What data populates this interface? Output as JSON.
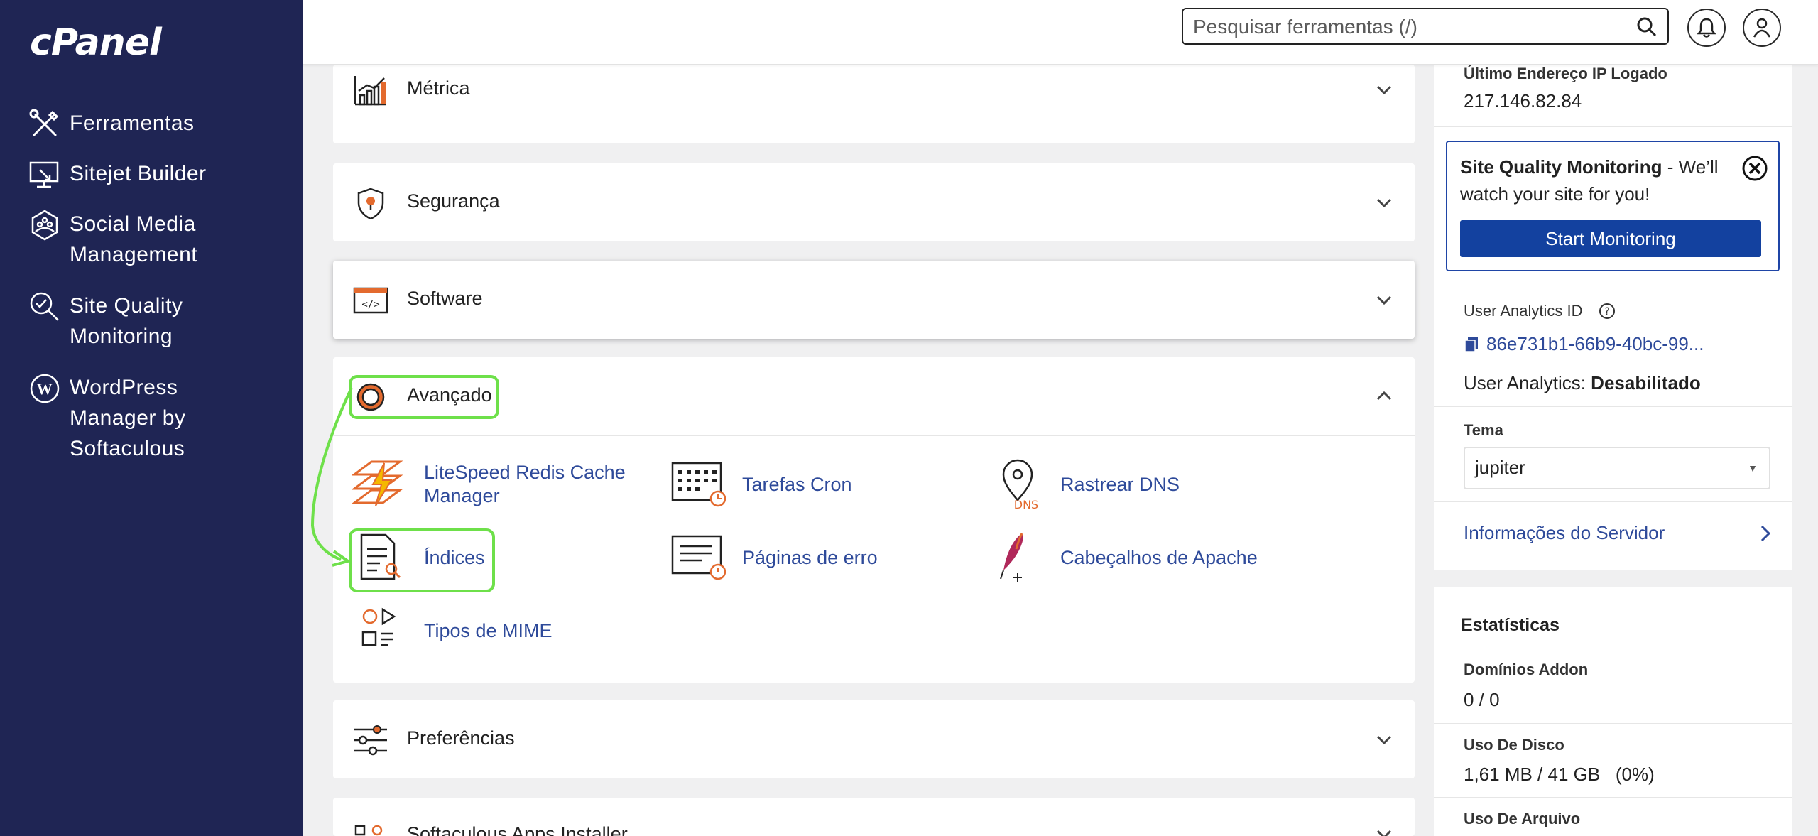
{
  "sidebar": {
    "logo": "cPanel",
    "items": [
      {
        "label": "Ferramentas",
        "icon": "tools-icon"
      },
      {
        "label": "Sitejet Builder",
        "icon": "monitor-builder-icon"
      },
      {
        "label": "Social Media\nManagement",
        "icon": "social-media-icon"
      },
      {
        "label": "Site Quality\nMonitoring",
        "icon": "magnifier-check-icon"
      },
      {
        "label": "WordPress\n   Manager by\nSoftaculous",
        "icon": "wordpress-icon"
      }
    ]
  },
  "topbar": {
    "search_placeholder": "Pesquisar ferramentas (/)",
    "notifications_icon": "bell-icon",
    "user_icon": "user-icon"
  },
  "sections": [
    {
      "title": "Métrica",
      "icon": "metrics-icon",
      "expanded": false
    },
    {
      "title": "Segurança",
      "icon": "security-shield-icon",
      "expanded": false
    },
    {
      "title": "Software",
      "icon": "software-code-icon",
      "expanded": false
    },
    {
      "title": "Avançado",
      "icon": "advanced-gear-icon",
      "expanded": true
    },
    {
      "title": "Preferências",
      "icon": "preferences-sliders-icon",
      "expanded": false
    },
    {
      "title": "Softaculous Apps Installer",
      "icon": "softaculous-icon",
      "expanded": false
    }
  ],
  "advanced_tools": [
    {
      "label": "LiteSpeed Redis Cache Manager",
      "icon": "litespeed-icon"
    },
    {
      "label": "Tarefas Cron",
      "icon": "cron-calendar-icon"
    },
    {
      "label": "Rastrear DNS",
      "icon": "dns-pin-icon"
    },
    {
      "label": "Índices",
      "icon": "indexes-document-icon"
    },
    {
      "label": "Páginas de erro",
      "icon": "error-pages-icon"
    },
    {
      "label": "Cabeçalhos de Apache",
      "icon": "apache-feather-icon"
    },
    {
      "label": "Tipos de MIME",
      "icon": "mime-types-icon"
    }
  ],
  "right": {
    "last_ip_label": "Último Endereço IP Logado",
    "last_ip_value": "217.146.82.84",
    "sqm_title": "Site Quality Monitoring",
    "sqm_text": " - We’ll watch your site for you!",
    "sqm_button": "Start Monitoring",
    "analytics_id_label": "User Analytics ID",
    "analytics_id_value": "86e731b1-66b9-40bc-99...",
    "analytics_status_label": "User Analytics: ",
    "analytics_status_value": "Desabilitado",
    "theme_label": "Tema",
    "theme_value": "jupiter",
    "server_info_link": "Informações do Servidor",
    "stats_title": "Estatísticas",
    "addon_label": "Domínios Addon",
    "addon_value": "0 / 0",
    "disk_label": "Uso De Disco",
    "disk_value": "1,61 MB / 41 GB   (0%)",
    "file_label": "Uso De Arquivo"
  },
  "colors": {
    "sidebar_bg": "#1f2554",
    "link_blue": "#2e4a9a",
    "button_blue": "#13419f",
    "icon_orange": "#e36a2e",
    "highlight_green": "#6ee04a"
  }
}
